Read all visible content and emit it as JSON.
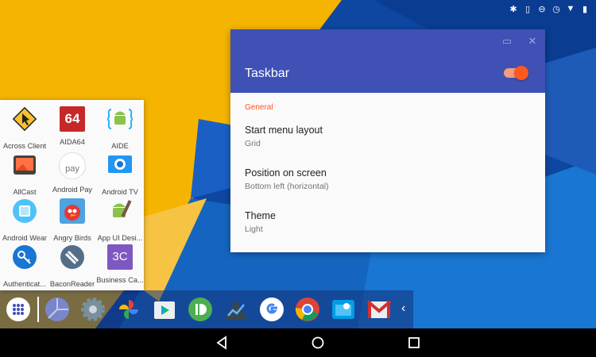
{
  "settings": {
    "title": "Taskbar",
    "enabled": true,
    "section": "General",
    "prefs": [
      {
        "title": "Start menu layout",
        "summary": "Grid"
      },
      {
        "title": "Position on screen",
        "summary": "Bottom left (horizontal)"
      },
      {
        "title": "Theme",
        "summary": "Light"
      }
    ],
    "accent": "#3f51b5",
    "toggle_color": "#ff5722"
  },
  "start_menu": {
    "apps": [
      {
        "label": "Across Client",
        "icon": "across-client-icon"
      },
      {
        "label": "AIDA64",
        "icon": "aida64-icon",
        "icon_text": "64"
      },
      {
        "label": "AIDE",
        "icon": "aide-icon"
      },
      {
        "label": "AllCast",
        "icon": "allcast-icon"
      },
      {
        "label": "Android Pay",
        "icon": "android-pay-icon",
        "icon_text": "pay"
      },
      {
        "label": "Android TV",
        "icon": "android-tv-icon"
      },
      {
        "label": "Android Wear",
        "icon": "android-wear-icon"
      },
      {
        "label": "Angry Birds",
        "icon": "angry-birds-icon"
      },
      {
        "label": "App UI Desi...",
        "icon": "app-ui-designer-icon"
      },
      {
        "label": "Authenticat...",
        "icon": "authenticator-icon"
      },
      {
        "label": "BaconReader",
        "icon": "baconreader-icon"
      },
      {
        "label": "Business Ca...",
        "icon": "business-card-icon",
        "icon_text": "3C"
      }
    ]
  },
  "taskbar": {
    "items": [
      "app-drawer-icon",
      "app-icon",
      "settings-icon",
      "photos-icon",
      "play-store-icon",
      "pushbullet-icon",
      "stocks-icon",
      "google-icon",
      "chrome-icon",
      "file-manager-icon",
      "gmail-icon",
      "collapse-chevron-icon"
    ],
    "chevron": "‹"
  },
  "status_icons": [
    "bluetooth-icon",
    "vibrate-icon",
    "do-not-disturb-icon",
    "alarm-icon",
    "wifi-icon",
    "battery-icon"
  ]
}
